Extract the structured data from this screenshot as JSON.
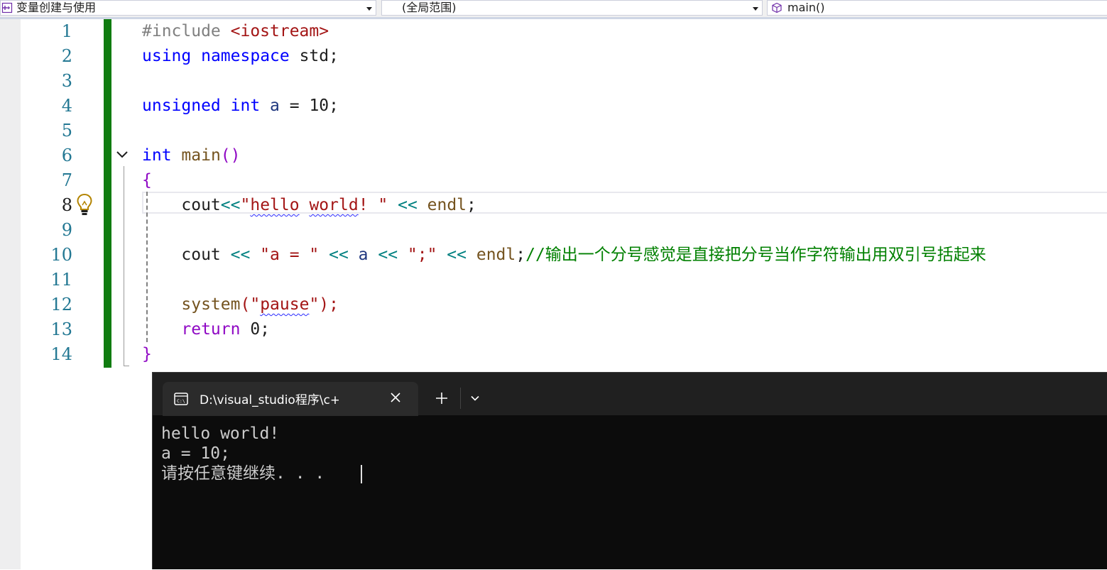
{
  "navbar": {
    "project": "变量创建与使用",
    "scope": "(全局范围)",
    "member": "main()"
  },
  "editor": {
    "line_numbers": [
      "1",
      "2",
      "3",
      "4",
      "5",
      "6",
      "7",
      "8",
      "9",
      "10",
      "11",
      "12",
      "13",
      "14"
    ],
    "current_line": "8",
    "lines": {
      "l1": {
        "a": "#include ",
        "b": "<iostream>"
      },
      "l2": {
        "a": "using",
        "b": " ",
        "c": "namespace",
        "d": " std;"
      },
      "l4": {
        "a": "unsigned",
        "b": " ",
        "c": "int",
        "d": " ",
        "e": "a",
        "f": " = 10;"
      },
      "l6": {
        "a": "int",
        "b": " ",
        "c": "main",
        "d": "()"
      },
      "l7": {
        "a": "{"
      },
      "l8": {
        "a": "    ",
        "b": "cout",
        "c": "<<",
        "d": "\"",
        "e": "hello",
        "f": " ",
        "g": "world",
        "h": "! \"",
        "i": " << ",
        "j": "endl",
        "k": ";"
      },
      "l10": {
        "a": "    ",
        "b": "cout",
        "c": " << ",
        "d": "\"a = \"",
        "e": " << ",
        "f": "a",
        "g": " << ",
        "h": "\";\"",
        "i": " << ",
        "j": "endl",
        "k": ";",
        "l": "//输出一个分号感觉是直接把分号当作字符输出用双引号括起来"
      },
      "l12": {
        "a": "    ",
        "b": "system",
        "c": "(\"",
        "d": "pause",
        "e": "\");"
      },
      "l13": {
        "a": "    ",
        "b": "return",
        "c": " 0;"
      },
      "l14": {
        "a": "}"
      }
    }
  },
  "terminal": {
    "tab_title": "D:\\visual_studio程序\\c++\\变量创建与使用",
    "output": [
      "hello world!",
      "a = 10;",
      "请按任意键继续. . ."
    ]
  },
  "colors": {
    "keyword": "#0000ff",
    "string": "#a31515",
    "comment": "#008000",
    "change_bar": "#107c10",
    "terminal_bg": "#0c0c0c"
  },
  "icons": [
    "project-icon",
    "member-icon",
    "fold-collapse-icon",
    "lightbulb-icon",
    "console-icon",
    "close-icon",
    "plus-icon",
    "chevron-down-icon"
  ]
}
